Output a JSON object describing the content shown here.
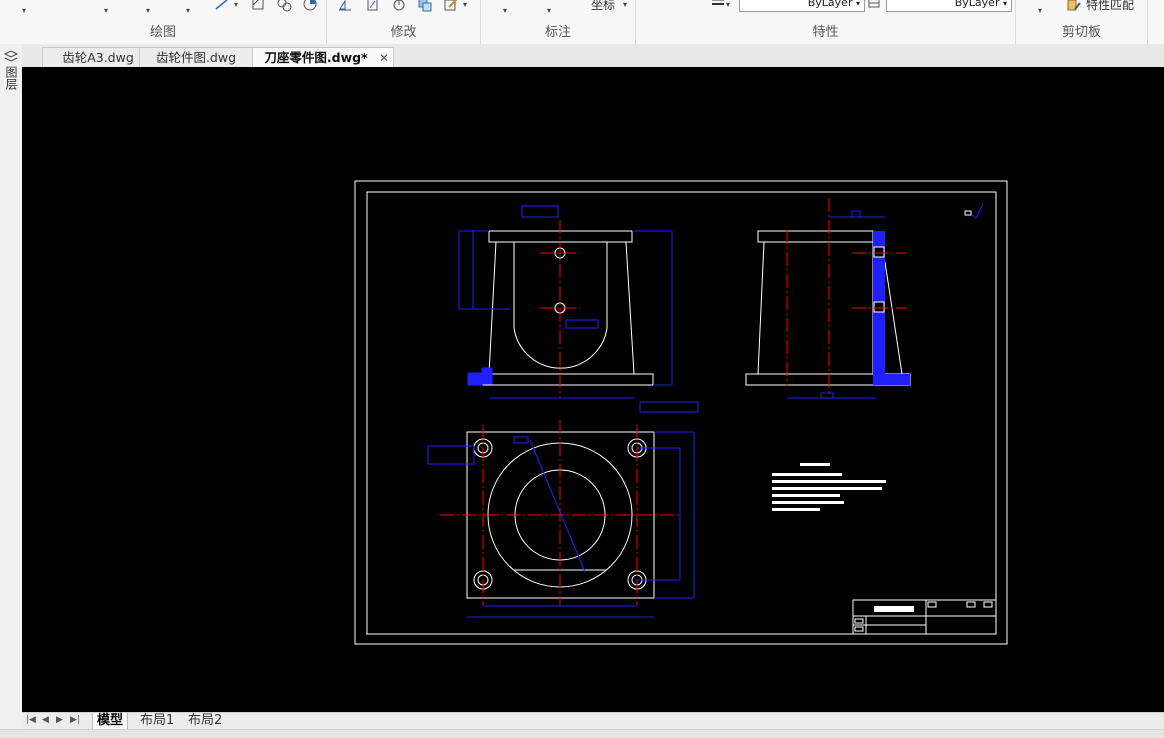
{
  "ribbon": {
    "panels": {
      "draw_title": "绘图",
      "modify_title": "修改",
      "annotate_title": "标注",
      "properties_title": "特性",
      "clipboard_title": "剪切板"
    },
    "tools": {
      "coordinate_label": "坐标",
      "match_properties_label": "特性匹配"
    },
    "combos": {
      "linetype_value": "ByLayer",
      "color_value": "ByLayer"
    },
    "icons": [
      "line-icon",
      "hatch-icon",
      "region-icon",
      "circle-icon",
      "mirror-icon",
      "offset-icon",
      "rotate-icon",
      "copy-icon",
      "edit-icon",
      "dimension-icon",
      "lineweight-icon",
      "match-properties-icon"
    ]
  },
  "side_strip": {
    "label": "图层"
  },
  "doc_tabs": [
    {
      "label": "齿轮A3.dwg"
    },
    {
      "label": "齿轮件图.dwg"
    },
    {
      "label": "刀座零件图.dwg*",
      "active": true
    }
  ],
  "layout_tabs": [
    {
      "label": "模型",
      "active": true
    },
    {
      "label": "布局1"
    },
    {
      "label": "布局2"
    }
  ],
  "drawing": {
    "title_block_text": "刀座零件图",
    "tech_req_title": "技术要求",
    "colors": {
      "background": "#000000",
      "outline": "#ffffff",
      "dimension": "#0000ff",
      "centerline": "#ff0000"
    }
  }
}
